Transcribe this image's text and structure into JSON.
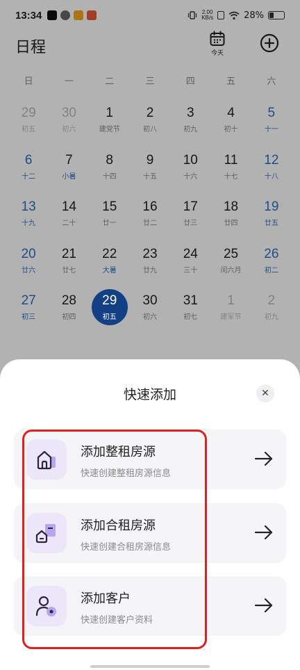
{
  "status": {
    "time": "13:34",
    "net_speed_value": "2.00",
    "net_speed_unit": "KB/s",
    "battery": "28%"
  },
  "header": {
    "title": "日程",
    "today_label": "今天"
  },
  "weekdays": [
    "日",
    "一",
    "二",
    "三",
    "四",
    "五",
    "六"
  ],
  "calendar": {
    "weeks": [
      [
        {
          "num": "29",
          "lunar": "初五"
        },
        {
          "num": "30",
          "lunar": "初六"
        },
        {
          "num": "1",
          "lunar": "建党节"
        },
        {
          "num": "2",
          "lunar": "初八"
        },
        {
          "num": "3",
          "lunar": "初九"
        },
        {
          "num": "4",
          "lunar": "初十"
        },
        {
          "num": "5",
          "lunar": "十一"
        }
      ],
      [
        {
          "num": "6",
          "lunar": "十二"
        },
        {
          "num": "7",
          "lunar": "小暑"
        },
        {
          "num": "8",
          "lunar": "十四"
        },
        {
          "num": "9",
          "lunar": "十五"
        },
        {
          "num": "10",
          "lunar": "十六"
        },
        {
          "num": "11",
          "lunar": "十七"
        },
        {
          "num": "12",
          "lunar": "十八"
        }
      ],
      [
        {
          "num": "13",
          "lunar": "十九"
        },
        {
          "num": "14",
          "lunar": "二十"
        },
        {
          "num": "15",
          "lunar": "廿一"
        },
        {
          "num": "16",
          "lunar": "廿二"
        },
        {
          "num": "17",
          "lunar": "廿三"
        },
        {
          "num": "18",
          "lunar": "廿四"
        },
        {
          "num": "19",
          "lunar": "廿五"
        }
      ],
      [
        {
          "num": "20",
          "lunar": "廿六"
        },
        {
          "num": "21",
          "lunar": "廿七"
        },
        {
          "num": "22",
          "lunar": "大暑"
        },
        {
          "num": "23",
          "lunar": "廿九"
        },
        {
          "num": "24",
          "lunar": "三十"
        },
        {
          "num": "25",
          "lunar": "闰六月"
        },
        {
          "num": "26",
          "lunar": "初二"
        }
      ],
      [
        {
          "num": "27",
          "lunar": "初三"
        },
        {
          "num": "28",
          "lunar": "初四"
        },
        {
          "num": "29",
          "lunar": "初五"
        },
        {
          "num": "30",
          "lunar": "初六"
        },
        {
          "num": "31",
          "lunar": "初七"
        },
        {
          "num": "1",
          "lunar": "建军节"
        },
        {
          "num": "2",
          "lunar": "初九"
        }
      ]
    ],
    "colors": {
      "weekend": "#2c6fc3",
      "selected_bg": "#1c5cbf"
    }
  },
  "sheet": {
    "title": "快速添加",
    "options": [
      {
        "title": "添加整租房源",
        "subtitle": "快速创建整租房源信息",
        "icon": "house-icon"
      },
      {
        "title": "添加合租房源",
        "subtitle": "快速创建合租房源信息",
        "icon": "shared-house-icon"
      },
      {
        "title": "添加客户",
        "subtitle": "快速创建客户资料",
        "icon": "customer-icon"
      }
    ],
    "colors": {
      "icon_bg": "#ebe7f8",
      "icon_accent": "#b7a6ee",
      "highlight": "#e01f1f"
    }
  }
}
